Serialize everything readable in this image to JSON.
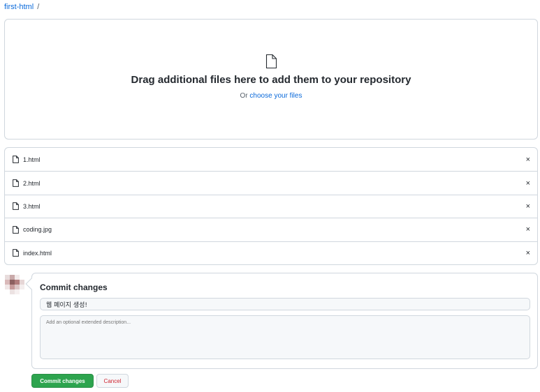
{
  "breadcrumb": {
    "repo": "first-html",
    "separator": "/"
  },
  "dropzone": {
    "icon": "file-icon",
    "title": "Drag additional files here to add them to your repository",
    "prefix": "Or",
    "link": "choose your files"
  },
  "files": [
    {
      "name": "1.html",
      "remove": "×"
    },
    {
      "name": "2.html",
      "remove": "×"
    },
    {
      "name": "3.html",
      "remove": "×"
    },
    {
      "name": "coding.jpg",
      "remove": "×"
    },
    {
      "name": "index.html",
      "remove": "×"
    }
  ],
  "commit": {
    "title": "Commit changes",
    "summary_value": "웹 페이지 생성!",
    "description_placeholder": "Add an optional extended description...",
    "commit_button": "Commit changes",
    "cancel_button": "Cancel"
  },
  "colors": {
    "link": "#0969da",
    "primary_button": "#2da44e",
    "cancel_text": "#cf222e",
    "border": "#d0d7de"
  }
}
